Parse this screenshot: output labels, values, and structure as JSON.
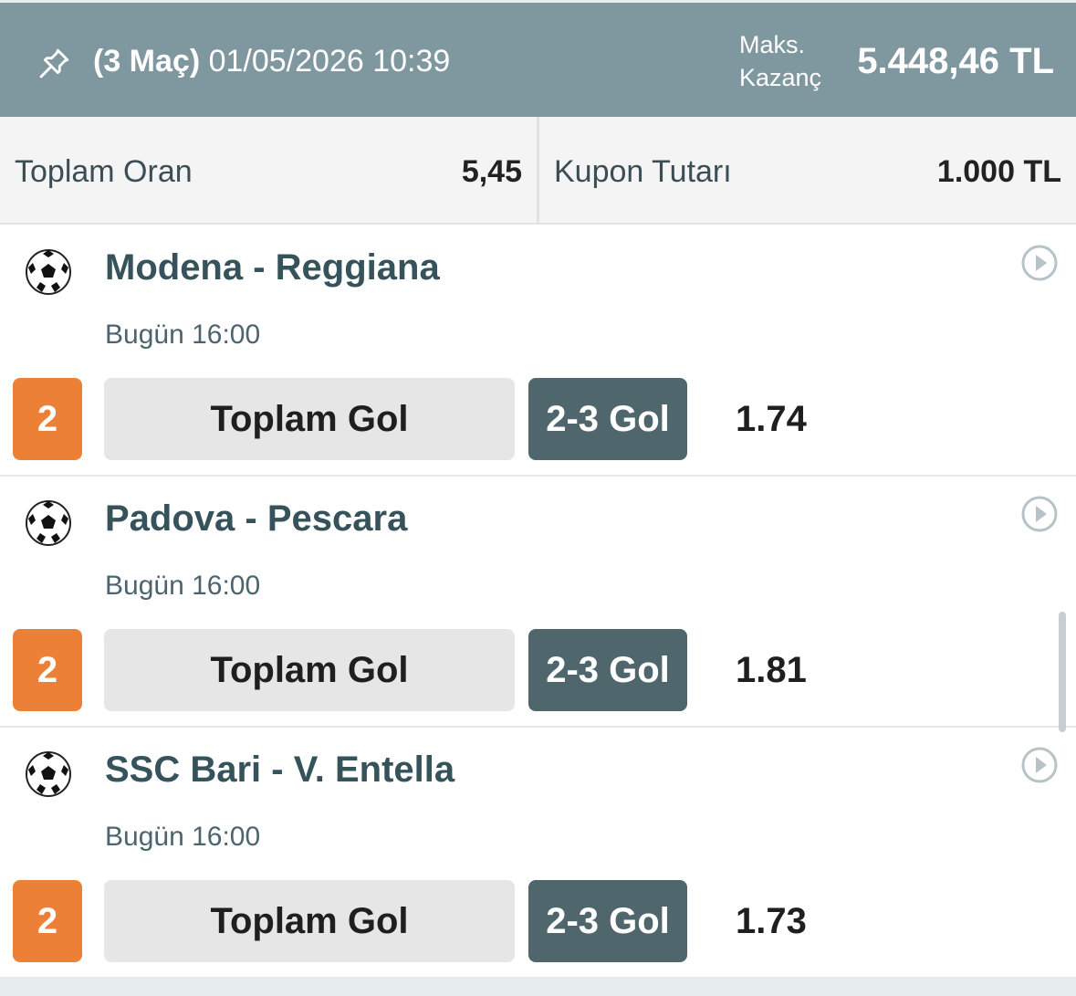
{
  "header": {
    "match_count": "(3 Maç)",
    "datetime": "01/05/2026 10:39",
    "max_win_label": "Maks. Kazanç",
    "max_win_value": "5.448,46 TL"
  },
  "summary": {
    "total_odds_label": "Toplam Oran",
    "total_odds_value": "5,45",
    "stake_label": "Kupon Tutarı",
    "stake_value": "1.000 TL"
  },
  "matches": [
    {
      "title": "Modena - Reggiana",
      "time": "Bugün 16:00",
      "pick": "2",
      "market": "Toplam Gol",
      "selection": "2-3 Gol",
      "odd": "1.74"
    },
    {
      "title": "Padova - Pescara",
      "time": "Bugün 16:00",
      "pick": "2",
      "market": "Toplam Gol",
      "selection": "2-3 Gol",
      "odd": "1.81"
    },
    {
      "title": "SSC Bari - V. Entella",
      "time": "Bugün 16:00",
      "pick": "2",
      "market": "Toplam Gol",
      "selection": "2-3 Gol",
      "odd": "1.73"
    }
  ],
  "icons": {
    "pin": "pin-icon",
    "sport": "soccer-ball-icon",
    "detail": "play-circle-icon"
  },
  "colors": {
    "header_bg": "#7f979f",
    "pick_badge": "#ec8036",
    "selection_bg": "#4f666d"
  }
}
